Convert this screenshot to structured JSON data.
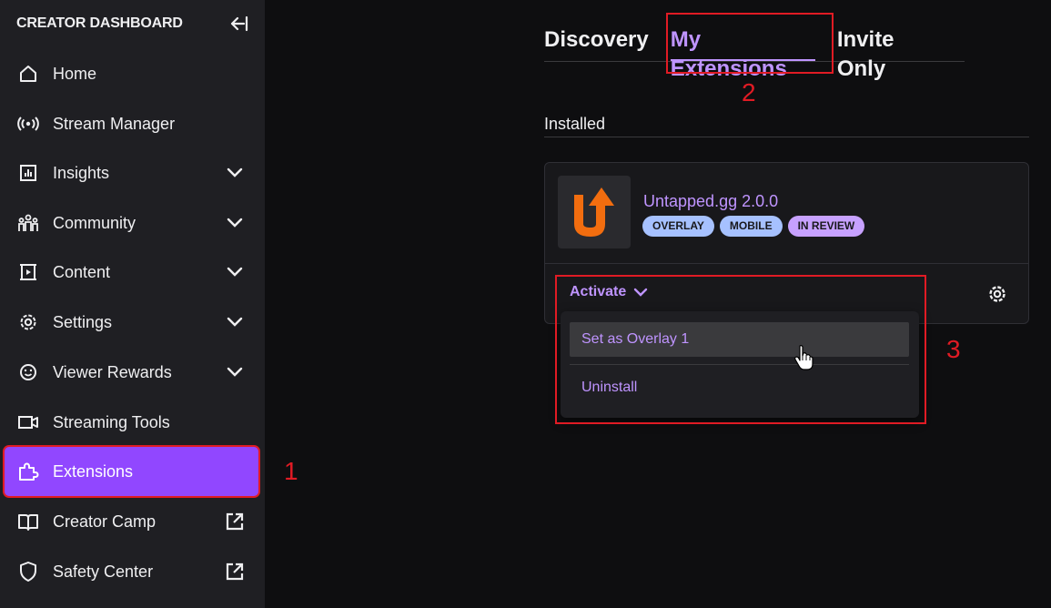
{
  "sidebar": {
    "title": "CREATOR DASHBOARD",
    "items": [
      {
        "label": "Home",
        "icon": "home-icon",
        "trail": ""
      },
      {
        "label": "Stream Manager",
        "icon": "broadcast-icon",
        "trail": ""
      },
      {
        "label": "Insights",
        "icon": "insights-icon",
        "trail": "chevron"
      },
      {
        "label": "Community",
        "icon": "community-icon",
        "trail": "chevron"
      },
      {
        "label": "Content",
        "icon": "content-icon",
        "trail": "chevron"
      },
      {
        "label": "Settings",
        "icon": "gear-icon",
        "trail": "chevron"
      },
      {
        "label": "Viewer Rewards",
        "icon": "rewards-icon",
        "trail": "chevron"
      },
      {
        "label": "Streaming Tools",
        "icon": "camera-icon",
        "trail": ""
      },
      {
        "label": "Extensions",
        "icon": "puzzle-icon",
        "trail": "",
        "active": true
      },
      {
        "label": "Creator Camp",
        "icon": "book-icon",
        "trail": "external"
      },
      {
        "label": "Safety Center",
        "icon": "shield-icon",
        "trail": "external"
      }
    ]
  },
  "annotations": {
    "one": "1",
    "two": "2",
    "three": "3"
  },
  "tabs": [
    {
      "label": "Discovery"
    },
    {
      "label": "My Extensions",
      "active": true
    },
    {
      "label": "Invite Only"
    }
  ],
  "section": {
    "installed": "Installed"
  },
  "extension": {
    "name": "Untapped.gg 2.0.0",
    "badges": [
      "OVERLAY",
      "MOBILE",
      "IN REVIEW"
    ],
    "activate_label": "Activate"
  },
  "dropdown": {
    "items": [
      "Set as Overlay 1",
      "Uninstall"
    ]
  },
  "colors": {
    "accent": "#9147ff",
    "accent_light": "#bf94ff",
    "annotation": "#e01b24",
    "logo_orange": "#f26d0f"
  }
}
